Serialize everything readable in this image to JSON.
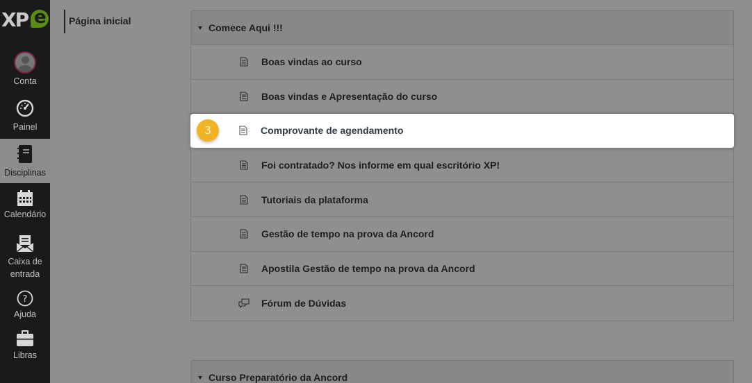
{
  "logo": {
    "text": "XP",
    "accent": "e"
  },
  "global_nav": [
    {
      "name": "conta",
      "label": "Conta",
      "icon": "avatar"
    },
    {
      "name": "painel",
      "label": "Painel",
      "icon": "speedometer-icon"
    },
    {
      "name": "disciplinas",
      "label": "Disciplinas",
      "icon": "notebook-icon",
      "active": true
    },
    {
      "name": "calendario",
      "label": "Calendário",
      "icon": "calendar-icon"
    },
    {
      "name": "caixa-de-entrada",
      "label_1": "Caixa de",
      "label_2": "entrada",
      "icon": "inbox-icon"
    },
    {
      "name": "ajuda",
      "label": "Ajuda",
      "icon": "help-icon"
    },
    {
      "name": "libras",
      "label": "Libras",
      "icon": "briefcase-icon"
    }
  ],
  "course_nav": {
    "home_label": "Página inicial"
  },
  "modules": [
    {
      "title": "Comece Aqui !!!",
      "items": [
        {
          "label": "Boas vindas ao curso",
          "icon": "page-icon"
        },
        {
          "label": "Boas vindas e Apresentação do curso",
          "icon": "page-icon"
        },
        {
          "label": "Comprovante de agendamento",
          "icon": "page-icon",
          "highlight": true,
          "badge": "3"
        },
        {
          "label": "Foi contratado? Nos informe em qual escritório XP!",
          "icon": "page-icon"
        },
        {
          "label": "Tutoriais da plataforma",
          "icon": "page-icon"
        },
        {
          "label": "Gestão de tempo na prova da Ancord",
          "icon": "page-icon"
        },
        {
          "label": "Apostila Gestão de tempo na prova da Ancord",
          "icon": "page-icon"
        },
        {
          "label": "Fórum de Dúvidas",
          "icon": "discussion-icon"
        }
      ]
    },
    {
      "title": "Curso Preparatório da Ancord",
      "items": []
    }
  ],
  "colors": {
    "badge": "#f0b323",
    "avatar_ring": "#7a1f4a",
    "logo_accent": "#5a8a18"
  }
}
